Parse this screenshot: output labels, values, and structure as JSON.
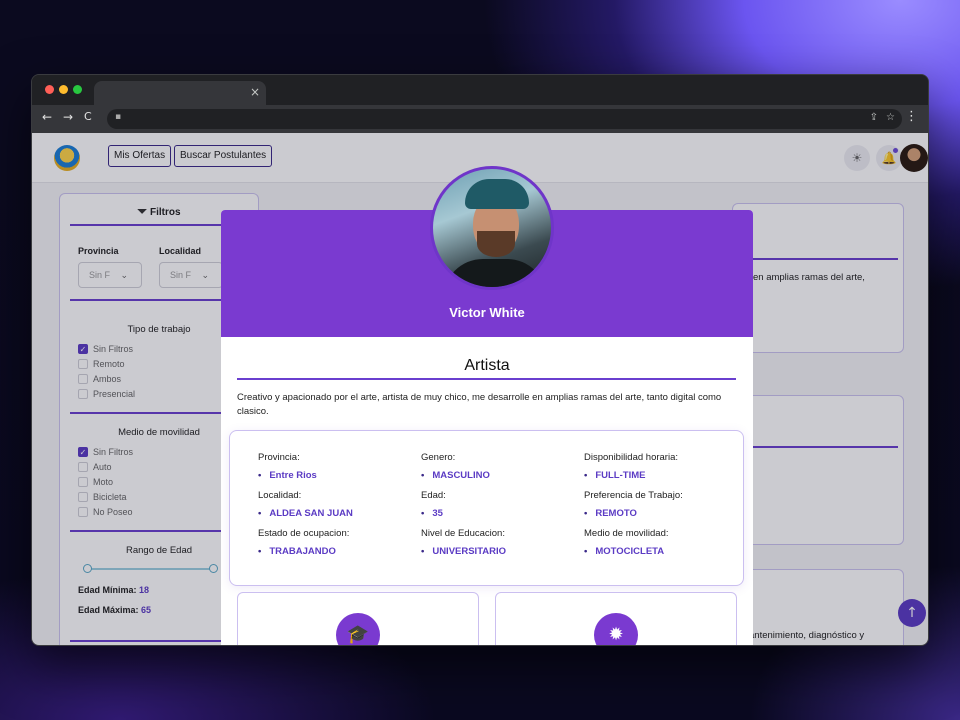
{
  "browser": {
    "tab_close": "×",
    "nav": {
      "back": "←",
      "forward": "→",
      "reload": "C"
    },
    "lock_icon": "lock-icon",
    "menu": "⋮"
  },
  "header": {
    "nav_links": [
      "Mis Ofertas",
      "Buscar Postulantes"
    ]
  },
  "filters": {
    "title": "Filtros",
    "provincia_label": "Provincia",
    "localidad_label": "Localidad",
    "provincia_value": "Sin F",
    "localidad_value": "Sin F",
    "tipo_trabajo": {
      "title": "Tipo de trabajo",
      "options": [
        {
          "label": "Sin Filtros",
          "checked": true
        },
        {
          "label": "Remoto",
          "checked": false
        },
        {
          "label": "Ambos",
          "checked": false
        },
        {
          "label": "Presencial",
          "checked": false
        }
      ]
    },
    "movilidad": {
      "title": "Medio de movilidad",
      "options": [
        {
          "label": "Sin Filtros",
          "checked": true
        },
        {
          "label": "Auto",
          "checked": false
        },
        {
          "label": "Moto",
          "checked": false
        },
        {
          "label": "Bicicleta",
          "checked": false
        },
        {
          "label": "No Poseo",
          "checked": false
        }
      ]
    },
    "rango_edad": {
      "title": "Rango de Edad",
      "min_label": "Edad Mínima:",
      "min_value": "18",
      "max_label": "Edad Máxima:",
      "max_value": "65"
    }
  },
  "background_cards": {
    "card1_text": "en amplias ramas del arte,",
    "card3_text": "antenimiento, diagnóstico y"
  },
  "modal": {
    "name": "Victor White",
    "title": "Artista",
    "description": "Creativo y apacionado por el arte, artista de muy chico, me desarrolle en amplias ramas del arte, tanto digital como clasico.",
    "info": {
      "provincia": {
        "label": "Provincia:",
        "value": "Entre Rios"
      },
      "localidad": {
        "label": "Localidad:",
        "value": "ALDEA SAN JUAN"
      },
      "ocupacion": {
        "label": "Estado de ocupacion:",
        "value": "TRABAJANDO"
      },
      "genero": {
        "label": "Genero:",
        "value": "MASCULINO"
      },
      "edad": {
        "label": "Edad:",
        "value": "35"
      },
      "educacion": {
        "label": "Nivel de Educacion:",
        "value": "UNIVERSITARIO"
      },
      "disponibilidad": {
        "label": "Disponibilidad horaria:",
        "value": "FULL-TIME"
      },
      "preferencia": {
        "label": "Preferencia de Trabajo:",
        "value": "REMOTO"
      },
      "movilidad": {
        "label": "Medio de movilidad:",
        "value": "MOTOCICLETA"
      }
    },
    "cards": [
      {
        "icon": "graduation-cap-icon",
        "glyph": "🎓"
      },
      {
        "icon": "badge-icon",
        "glyph": "✹"
      }
    ]
  },
  "colors": {
    "accent": "#7a3ad0",
    "accent_dark": "#5b3bc4"
  }
}
